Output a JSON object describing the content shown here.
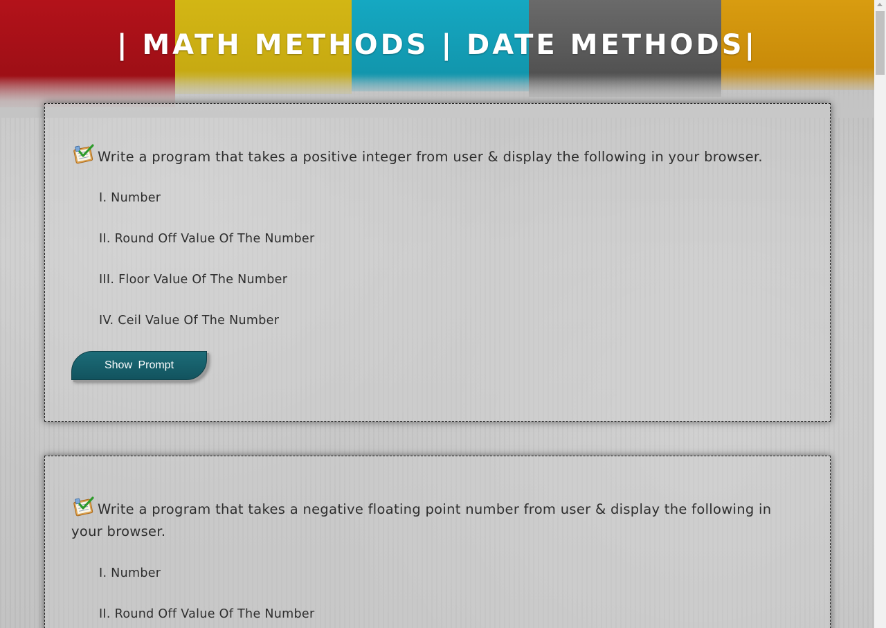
{
  "header": {
    "title": "| MATH METHODS | DATE METHODS|",
    "stripe_colors": [
      "#b3121a",
      "#d3b614",
      "#15a8c2",
      "#5f5f5f",
      "#d89c10"
    ]
  },
  "tasks": [
    {
      "prompt": "Write a program that takes a positive integer from user & display the following in your browser.",
      "icon": "todo-checklist-icon",
      "items": [
        "I. Number",
        "II. Round Off Value Of The Number",
        "III. Floor Value Of The Number",
        "IV. Ceil Value Of The Number"
      ],
      "button_label": "Show Prompt"
    },
    {
      "prompt": "Write a program that takes a negative floating point number from user & display the following in your browser.",
      "icon": "todo-checklist-icon",
      "items": [
        "I. Number",
        "II. Round Off Value Of The Number"
      ]
    }
  ],
  "colors": {
    "button": "#166170",
    "text": "#2d2d2d"
  }
}
